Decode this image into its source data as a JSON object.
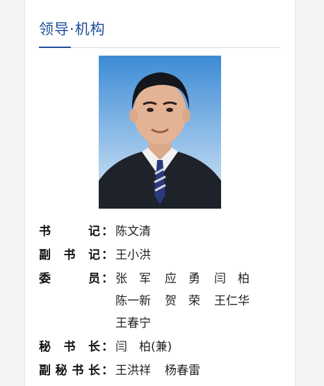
{
  "section": {
    "title": "领导·机构"
  },
  "portrait": {
    "icon": "leader-portrait-photo",
    "background_top": "#3d8bd6",
    "background_bottom": "#d8e9f7"
  },
  "leaders": [
    {
      "label": "书记",
      "colon": "：",
      "lines": [
        [
          "陈文清"
        ]
      ]
    },
    {
      "label": "副书记",
      "colon": "：",
      "lines": [
        [
          "王小洪"
        ]
      ]
    },
    {
      "label": "委员",
      "colon": "：",
      "lines": [
        [
          "张　军",
          "应　勇",
          "闫　柏"
        ],
        [
          "陈一新",
          "贺　荣",
          "王仁华"
        ],
        [
          "王春宁"
        ]
      ]
    },
    {
      "label": "秘书长",
      "colon": "：",
      "lines": [
        [
          "闫　柏(兼)"
        ]
      ]
    },
    {
      "label": "副秘书长",
      "colon": "：",
      "lines": [
        [
          "王洪祥",
          "杨春雷"
        ]
      ]
    }
  ],
  "colors": {
    "title": "#1f4e96",
    "accent": "#1f4e96",
    "label": "#111111",
    "value": "#222222"
  }
}
